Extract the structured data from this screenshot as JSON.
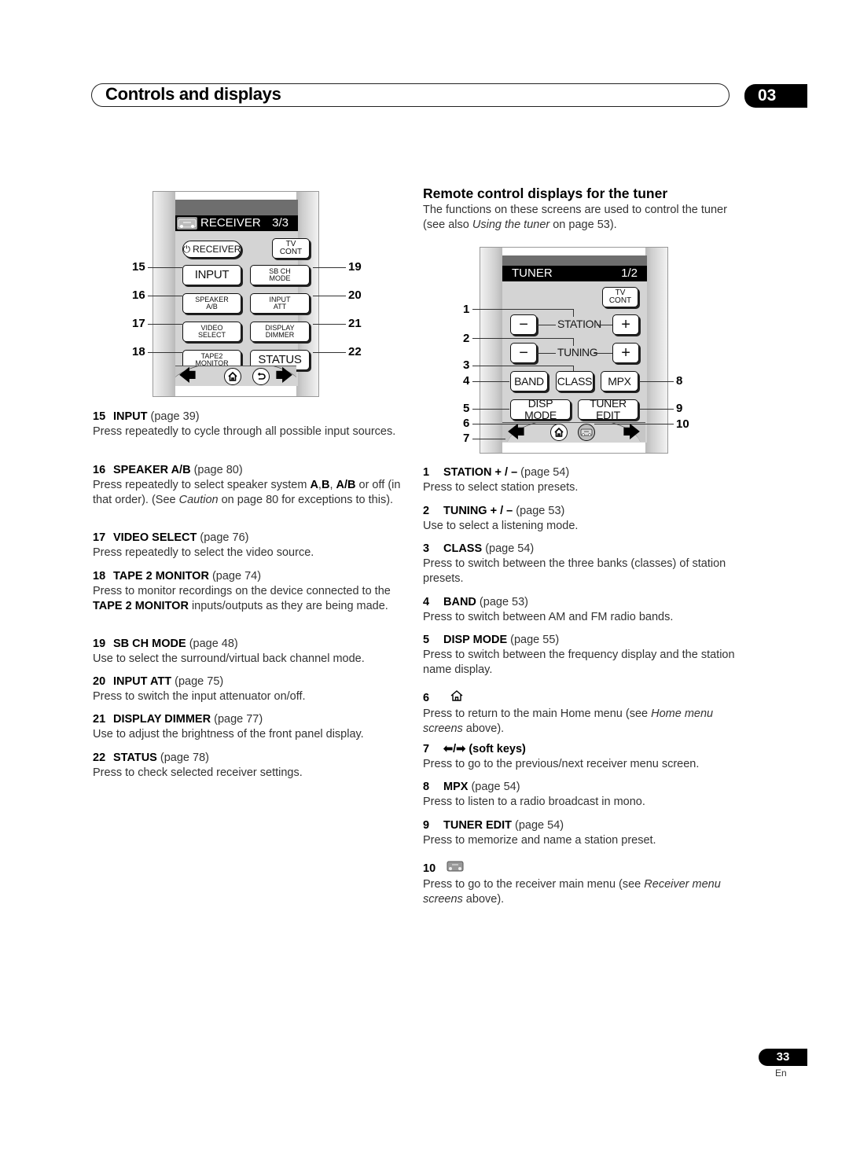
{
  "header": {
    "title": "Controls and displays",
    "chapter": "03"
  },
  "receiver_panel": {
    "title": "RECEIVER",
    "page": "3/3",
    "power_button": "RECEIVER",
    "tv_cont": [
      "TV",
      "CONT"
    ],
    "buttons": [
      {
        "id": 15,
        "lines": [
          "INPUT"
        ]
      },
      {
        "id": 19,
        "lines": [
          "SB CH",
          "MODE"
        ]
      },
      {
        "id": 16,
        "lines": [
          "SPEAKER",
          "A/B"
        ]
      },
      {
        "id": 20,
        "lines": [
          "INPUT",
          "ATT"
        ]
      },
      {
        "id": 17,
        "lines": [
          "VIDEO",
          "SELECT"
        ]
      },
      {
        "id": 21,
        "lines": [
          "DISPLAY",
          "DIMMER"
        ]
      },
      {
        "id": 18,
        "lines": [
          "TAPE2",
          "MONITOR"
        ]
      },
      {
        "id": 22,
        "lines": [
          "STATUS"
        ]
      }
    ],
    "callouts_left": [
      "15",
      "16",
      "17",
      "18"
    ],
    "callouts_right": [
      "19",
      "20",
      "21",
      "22"
    ],
    "icons": [
      "home-icon",
      "back-icon",
      "left-arrow-icon",
      "right-arrow-icon"
    ]
  },
  "receiver_items": [
    {
      "num": "15",
      "name": "INPUT",
      "page": "(page 39)",
      "desc": "Press repeatedly to cycle through all possible input sources."
    },
    {
      "num": "16",
      "name": "SPEAKER A/B",
      "page": "(page 80)",
      "desc_parts": [
        "Press repeatedly to select speaker system ",
        "A",
        ",",
        "B",
        ", ",
        "A/B",
        " or off (in that order). (See ",
        "Caution",
        " on page 80 for exceptions to this)."
      ]
    },
    {
      "num": "17",
      "name": "VIDEO SELECT",
      "page": "(page 76)",
      "desc": "Press repeatedly to select the video source."
    },
    {
      "num": "18",
      "name": "TAPE 2 MONITOR",
      "page": "(page 74)",
      "desc_parts": [
        "Press to monitor recordings on the device connected to the ",
        "TAPE 2 MONITOR",
        " inputs/outputs as they are being made."
      ]
    },
    {
      "num": "19",
      "name": "SB CH MODE",
      "page": "(page 48)",
      "desc": "Use to select the surround/virtual back channel mode."
    },
    {
      "num": "20",
      "name": "INPUT ATT",
      "page": "(page 75)",
      "desc": "Press to switch the input attenuator on/off."
    },
    {
      "num": "21",
      "name": "DISPLAY DIMMER",
      "page": "(page 77)",
      "desc": "Use to adjust the brightness of the front panel display."
    },
    {
      "num": "22",
      "name": "STATUS",
      "page": "(page 78)",
      "desc": "Press to check selected receiver settings."
    }
  ],
  "tuner_section": {
    "title": "Remote control displays for the tuner",
    "intro_parts": [
      "The functions on these screens are used to control the tuner (see also ",
      "Using the tuner",
      " on page 53)."
    ]
  },
  "tuner_panel": {
    "title": "TUNER",
    "page": "1/2",
    "tv_cont": [
      "TV",
      "CONT"
    ],
    "station_label": "STATION",
    "tuning_label": "TUNING",
    "minus": "−",
    "plus": "+",
    "band": "BAND",
    "class": "CLASS",
    "mpx": "MPX",
    "disp_mode": "DISP MODE",
    "tuner_edit": "TUNER EDIT",
    "callouts_left": [
      "1",
      "2",
      "3",
      "4",
      "5",
      "6",
      "7"
    ],
    "callouts_right": [
      "8",
      "9",
      "10"
    ]
  },
  "tuner_items": [
    {
      "num": "1",
      "name": "STATION + / –",
      "page": " (page 54)",
      "desc": "Press to select station presets."
    },
    {
      "num": "2",
      "name": "TUNING + / –",
      "page": "(page 53)",
      "desc": "Use to select a listening mode."
    },
    {
      "num": "3",
      "name": "CLASS",
      "page": "(page 54)",
      "desc": "Press to switch between the three banks (classes) of station presets."
    },
    {
      "num": "4",
      "name": "BAND",
      "page": "(page 53)",
      "desc": "Press to switch between AM and FM radio bands."
    },
    {
      "num": "5",
      "name": "DISP MODE",
      "page": "(page 55)",
      "desc": "Press to switch between the frequency display and the station name display."
    },
    {
      "num": "6",
      "icon": "home-icon",
      "desc_parts": [
        "Press to return to the main Home menu (see ",
        "Home menu screens",
        " above)."
      ]
    },
    {
      "num": "7",
      "name": "⬅/➡ (soft keys)",
      "desc": "Press to go to the previous/next receiver menu screen."
    },
    {
      "num": "8",
      "name": "MPX",
      "page": "(page 54)",
      "desc": "Press to listen to a radio broadcast in mono."
    },
    {
      "num": "9",
      "name": "TUNER EDIT",
      "page": "(page 54)",
      "desc": "Press to memorize and name a station preset."
    },
    {
      "num": "10",
      "icon": "receiver-icon",
      "desc_parts": [
        "Press to go to the receiver main menu (see ",
        "Receiver menu screens",
        " above)."
      ]
    }
  ],
  "footer": {
    "page_number": "33",
    "language": "En"
  }
}
